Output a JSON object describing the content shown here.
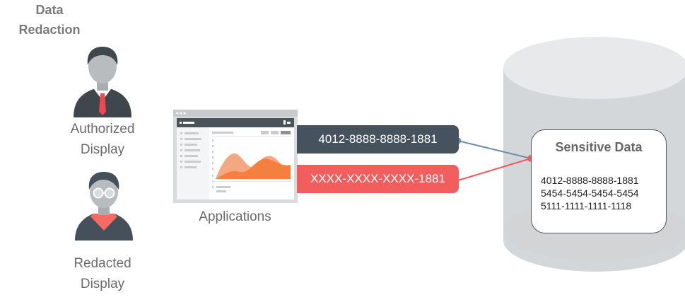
{
  "title": "Data\nRedaction",
  "authorized_label": "Authorized\nDisplay",
  "redacted_label": "Redacted\nDisplay",
  "applications_label": "Applications",
  "authorized_value": "4012-8888-8888-1881",
  "redacted_value": "XXXX-XXXX-XXXX-1881",
  "sensitive_data": {
    "title": "Sensitive Data",
    "rows": [
      "4012-8888-8888-1881",
      "5454-5454-5454-5454",
      "5111-1111-1111-1118"
    ]
  },
  "colors": {
    "authorized_tag": "#46525d",
    "redacted_tag": "#f25d5d",
    "authorized_line": "#6b8fa8",
    "redacted_line": "#f05a5f",
    "cylinder_top": "#e7e9ea",
    "cylinder_body": "#d4d7d9"
  },
  "icons": {
    "authorized_user": "businessman-icon",
    "redacted_user": "person-with-glasses-icon",
    "application": "dashboard-window-icon",
    "database": "database-cylinder-icon"
  }
}
